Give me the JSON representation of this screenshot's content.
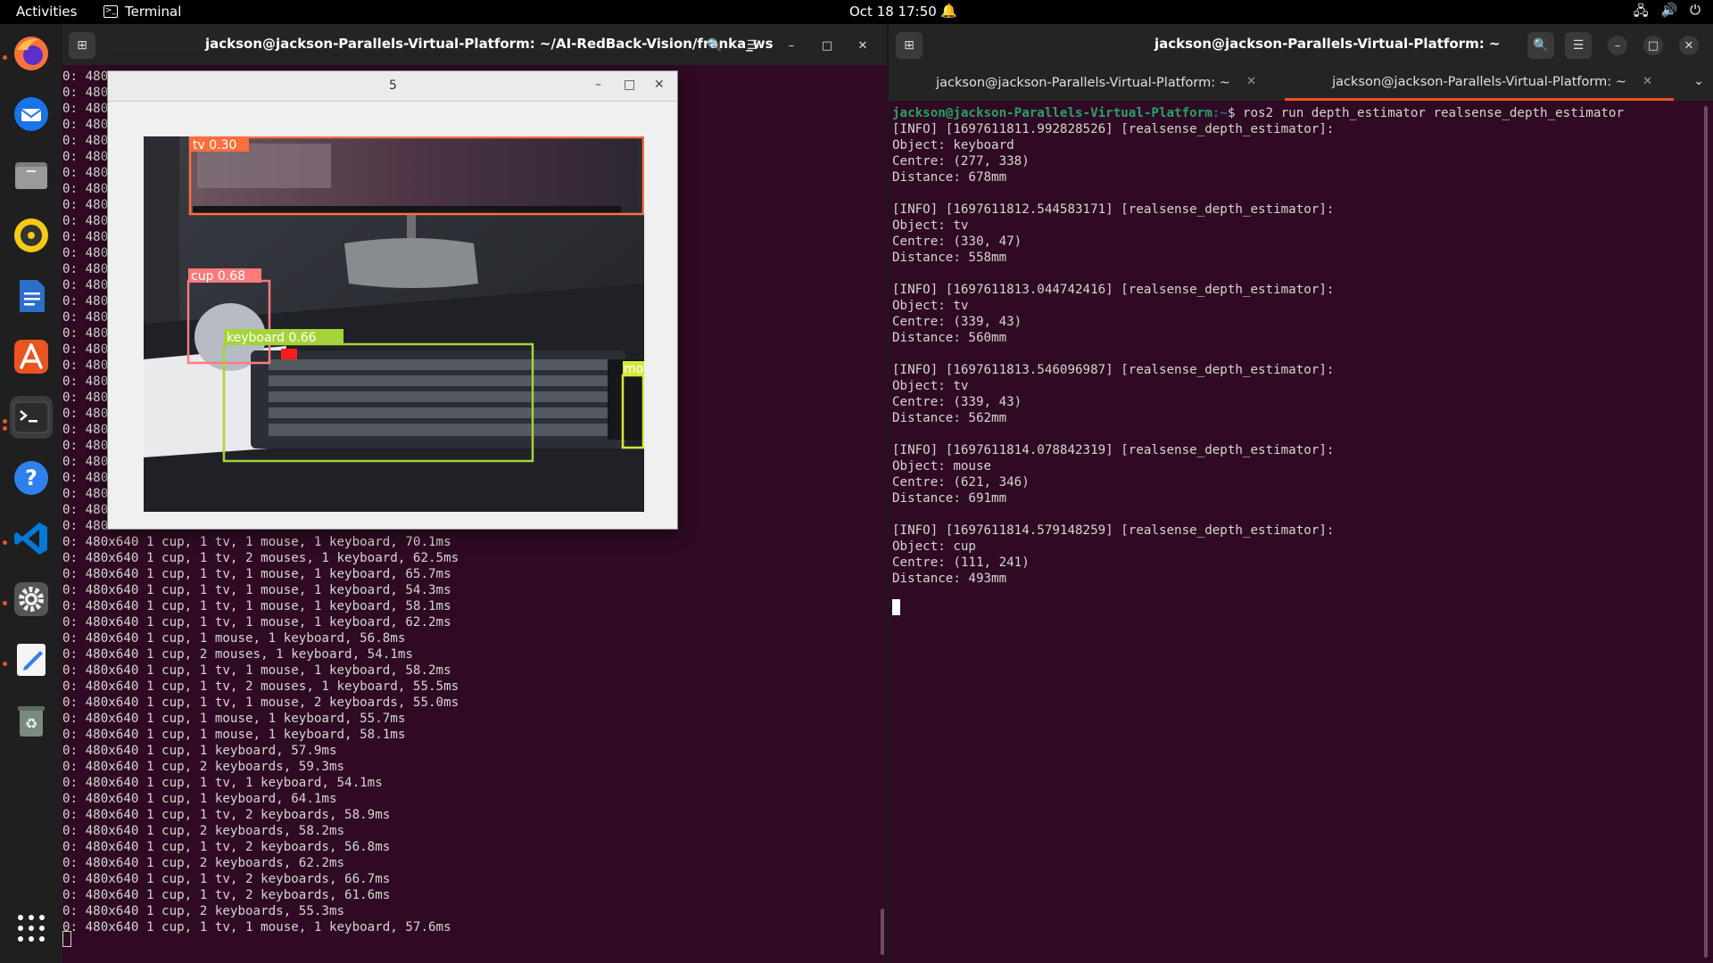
{
  "topbar": {
    "activities": "Activities",
    "app_name": "Terminal",
    "clock": "Oct 18  17:50"
  },
  "dock": {
    "items": [
      "firefox-icon",
      "thunderbird-icon",
      "files-icon",
      "rhythmbox-icon",
      "libreoffice-writer-icon",
      "app-center-icon",
      "terminal-icon",
      "help-icon",
      "vscode-icon",
      "settings-icon",
      "text-editor-icon",
      "trash-icon",
      "show-apps-icon"
    ]
  },
  "left_window": {
    "title": "jackson@jackson-Parallels-Virtual-Platform: ~/AI-RedBack-Vision/franka_ws",
    "partial_line": "0: 480",
    "lines": [
      "0: 480x640 1 cup, 1 tv, 1 mouse, 1 keyboard, 70.1ms",
      "0: 480x640 1 cup, 1 tv, 2 mouses, 1 keyboard, 62.5ms",
      "0: 480x640 1 cup, 1 tv, 1 mouse, 1 keyboard, 65.7ms",
      "0: 480x640 1 cup, 1 tv, 1 mouse, 1 keyboard, 54.3ms",
      "0: 480x640 1 cup, 1 tv, 1 mouse, 1 keyboard, 58.1ms",
      "0: 480x640 1 cup, 1 tv, 1 mouse, 1 keyboard, 62.2ms",
      "0: 480x640 1 cup, 1 mouse, 1 keyboard, 56.8ms",
      "0: 480x640 1 cup, 2 mouses, 1 keyboard, 54.1ms",
      "0: 480x640 1 cup, 1 tv, 1 mouse, 1 keyboard, 58.2ms",
      "0: 480x640 1 cup, 1 tv, 2 mouses, 1 keyboard, 55.5ms",
      "0: 480x640 1 cup, 1 tv, 1 mouse, 2 keyboards, 55.0ms",
      "0: 480x640 1 cup, 1 mouse, 1 keyboard, 55.7ms",
      "0: 480x640 1 cup, 1 mouse, 1 keyboard, 58.1ms",
      "0: 480x640 1 cup, 1 keyboard, 57.9ms",
      "0: 480x640 1 cup, 2 keyboards, 59.3ms",
      "0: 480x640 1 cup, 1 tv, 1 keyboard, 54.1ms",
      "0: 480x640 1 cup, 1 keyboard, 64.1ms",
      "0: 480x640 1 cup, 1 tv, 2 keyboards, 58.9ms",
      "0: 480x640 1 cup, 2 keyboards, 58.2ms",
      "0: 480x640 1 cup, 1 tv, 2 keyboards, 56.8ms",
      "0: 480x640 1 cup, 2 keyboards, 62.2ms",
      "0: 480x640 1 cup, 1 tv, 2 keyboards, 66.7ms",
      "0: 480x640 1 cup, 1 tv, 2 keyboards, 61.6ms",
      "0: 480x640 1 cup, 2 keyboards, 55.3ms",
      "0: 480x640 1 cup, 1 tv, 1 mouse, 1 keyboard, 57.6ms"
    ]
  },
  "image_window": {
    "title": "5",
    "detections": [
      {
        "label": "tv 0.30",
        "color": "#ff6e3c"
      },
      {
        "label": "cup 0.68",
        "color": "#ff7a7a"
      },
      {
        "label": "keyboard 0.66",
        "color": "#a6d33a"
      },
      {
        "label": "mo",
        "color": "#d7e83a"
      }
    ]
  },
  "right_window": {
    "title": "jackson@jackson-Parallels-Virtual-Platform: ~",
    "tabs": [
      {
        "label": "jackson@jackson-Parallels-Virtual-Platform: ~"
      },
      {
        "label": "jackson@jackson-Parallels-Virtual-Platform: ~"
      }
    ],
    "prompt_user": "jackson@jackson-Parallels-Virtual-Platform",
    "prompt_path": ":~",
    "prompt_cmd": "$ ros2 run depth_estimator realsense_depth_estimator",
    "entries": [
      {
        "header": "[INFO] [1697611811.992828526] [realsense_depth_estimator]:",
        "object": "Object: keyboard",
        "centre": "Centre: (277, 338)",
        "distance": "Distance: 678mm"
      },
      {
        "header": "[INFO] [1697611812.544583171] [realsense_depth_estimator]:",
        "object": "Object: tv",
        "centre": "Centre: (330, 47)",
        "distance": "Distance: 558mm"
      },
      {
        "header": "[INFO] [1697611813.044742416] [realsense_depth_estimator]:",
        "object": "Object: tv",
        "centre": "Centre: (339, 43)",
        "distance": "Distance: 560mm"
      },
      {
        "header": "[INFO] [1697611813.546096987] [realsense_depth_estimator]:",
        "object": "Object: tv",
        "centre": "Centre: (339, 43)",
        "distance": "Distance: 562mm"
      },
      {
        "header": "[INFO] [1697611814.078842319] [realsense_depth_estimator]:",
        "object": "Object: mouse",
        "centre": "Centre: (621, 346)",
        "distance": "Distance: 691mm"
      },
      {
        "header": "[INFO] [1697611814.579148259] [realsense_depth_estimator]:",
        "object": "Object: cup",
        "centre": "Centre: (111, 241)",
        "distance": "Distance: 493mm"
      }
    ]
  }
}
